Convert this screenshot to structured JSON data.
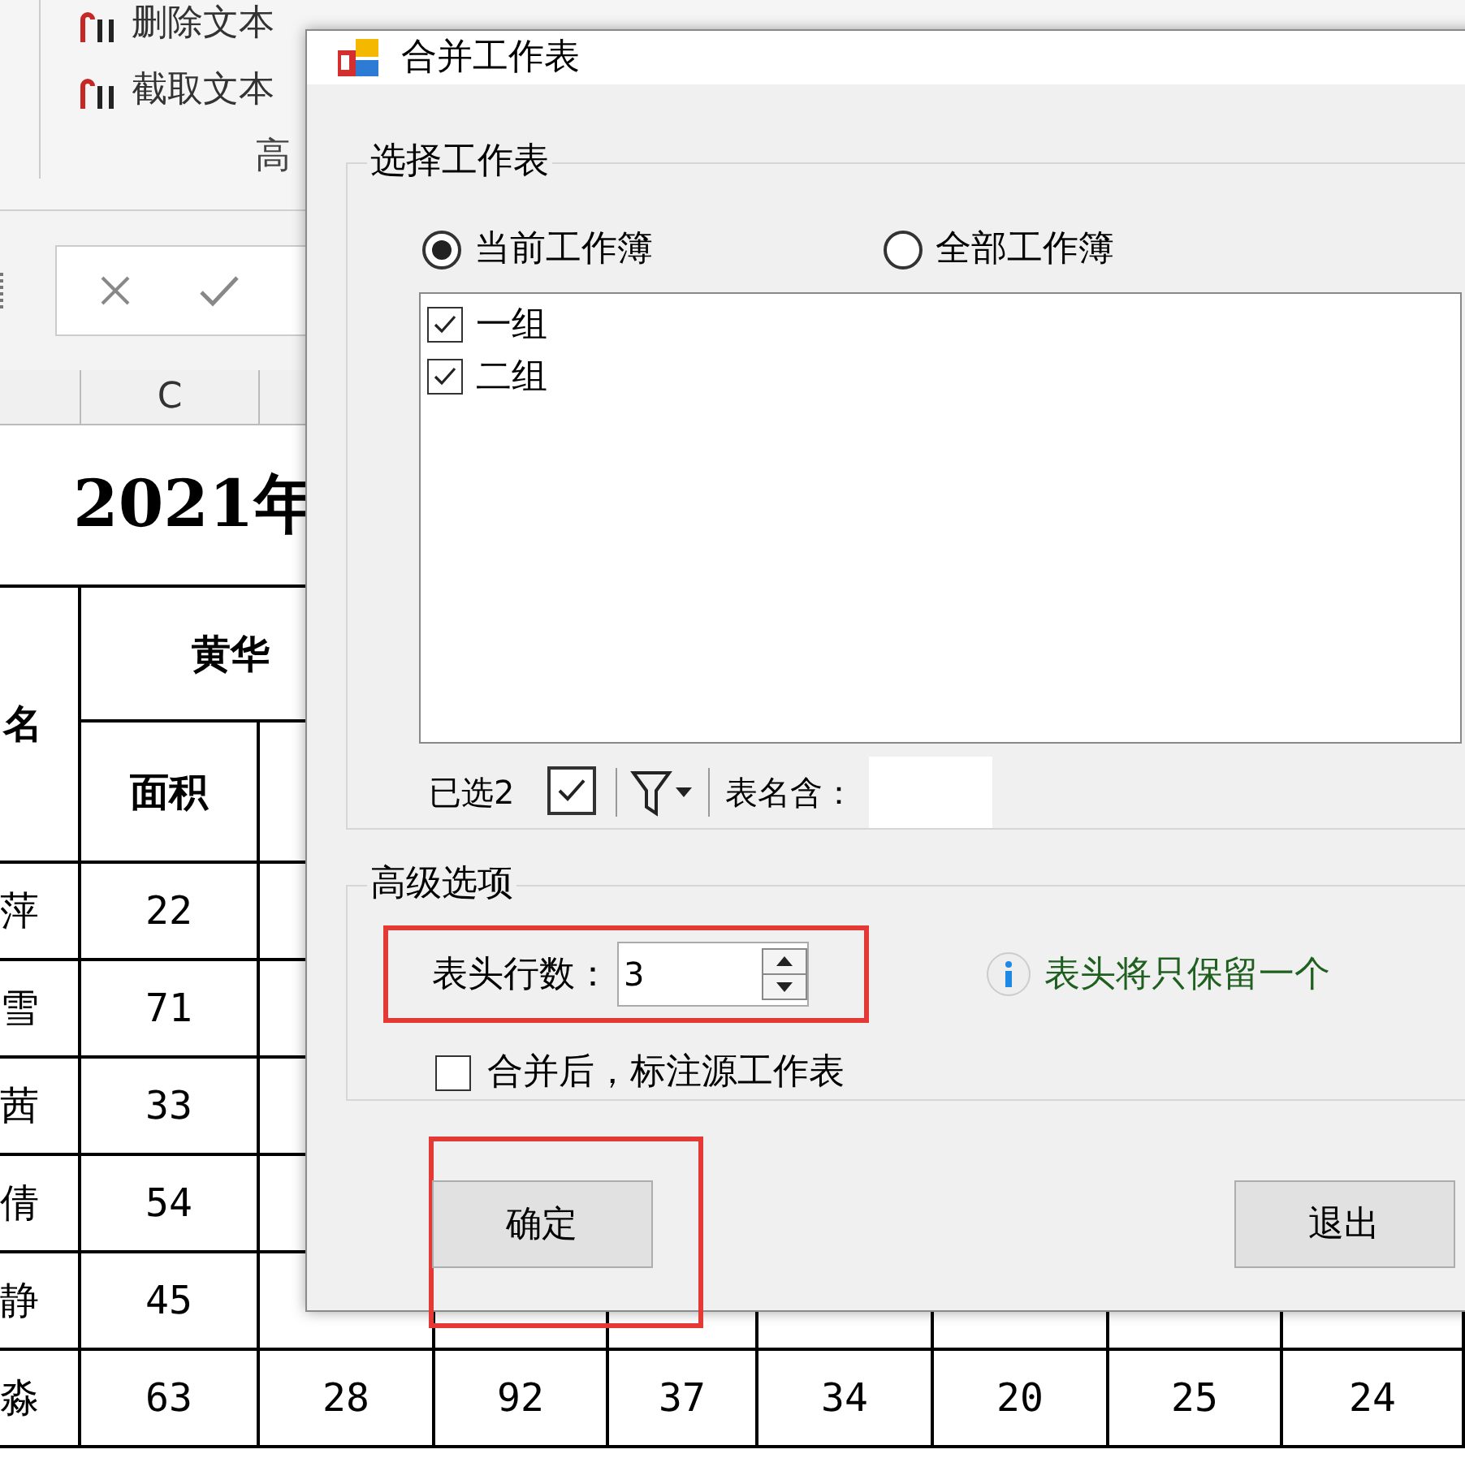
{
  "ribbon": {
    "items": [
      {
        "label": "删除文本"
      },
      {
        "label": "截取文本"
      }
    ],
    "group_label": "高"
  },
  "sheet": {
    "column_header": "C",
    "title": "2021年",
    "name_header": "名",
    "group_header": "黄华",
    "sub_header": "面积",
    "rows": [
      {
        "name": "萍",
        "values": [
          "22"
        ]
      },
      {
        "name": "雪",
        "values": [
          "71"
        ]
      },
      {
        "name": "茜",
        "values": [
          "33"
        ]
      },
      {
        "name": "倩",
        "values": [
          "54"
        ]
      },
      {
        "name": "静",
        "values": [
          "45"
        ]
      },
      {
        "name": "淼",
        "values": [
          "63",
          "28",
          "92",
          "37",
          "34",
          "20",
          "25",
          "24"
        ]
      }
    ]
  },
  "dialog": {
    "title": "合并工作表",
    "select_group": {
      "legend": "选择工作表",
      "scopes": [
        {
          "label": "当前工作簿",
          "selected": true
        },
        {
          "label": "全部工作簿",
          "selected": false
        }
      ],
      "sheets": [
        {
          "label": "一组",
          "checked": true
        },
        {
          "label": "二组",
          "checked": true
        }
      ],
      "selected_count": "已选2",
      "select_all_checked": true,
      "name_filter_label": "表名含："
    },
    "advanced": {
      "legend": "高级选项",
      "header_rows_label": "表头行数：",
      "header_rows_value": "3",
      "highlighted": true,
      "hint": "表头将只保留一个",
      "mark_source": {
        "label": "合并后，标注源工作表",
        "checked": false
      }
    },
    "buttons": [
      {
        "label": "确定",
        "highlighted": true
      },
      {
        "label": "退出",
        "highlighted": false
      }
    ]
  }
}
